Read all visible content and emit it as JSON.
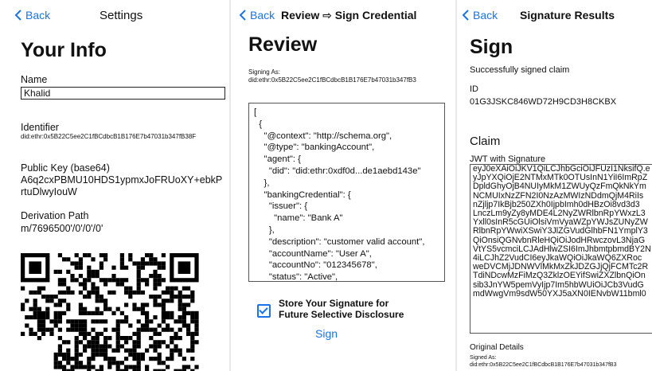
{
  "screen1": {
    "back_label": "Back",
    "nav_title": "Settings",
    "heading": "Your Info",
    "name_label": "Name",
    "name_value": "Khalid",
    "identifier_label": "Identifier",
    "identifier_value": "did:ethr:0x5B22C5ee2C1fBCdbcB1B176E7b47031b347fB38F",
    "pubkey_label": "Public Key (base64)",
    "pubkey_value": "A6q2cxPBMU10HDS1ypmxJoFRUoXY+ebkPrtuDlwyIouW",
    "derivation_label": "Derivation Path",
    "derivation_value": "m/7696500'/0'/0'/0'"
  },
  "screen2": {
    "back_label": "Back",
    "nav_title": "Review ⇨ Sign Credential",
    "heading": "Review",
    "signing_as_label": "Signing As:",
    "signing_as_value": "did:ethr:0x5B22C5ee2C1fBCdbcB1B176E7b47031b347fB3",
    "credential_json": "[\n  {\n    \"@context\": \"http://schema.org\",\n    \"@type\": \"bankingAccount\",\n    \"agent\": {\n      \"did\": \"did:ethr:0xdf0d...de1aebd143e\"\n    },\n    \"bankingCredential\": {\n      \"issuer\": {\n        \"name\": \"Bank A\"\n      },\n      \"description\": \"customer valid account\",\n      \"accountName\": \"User A\",\n      \"accountNo\": \"012345678\",\n      \"status\": \"Active\",\n      \"time\":",
    "checkbox_label": "Store Your Signature for Future Selective Disclosure",
    "checkbox_checked": true,
    "sign_button": "Sign"
  },
  "screen3": {
    "back_label": "Back",
    "nav_title": "Signature Results",
    "heading": "Sign",
    "status_text": "Successfully signed claim",
    "id_label": "ID",
    "id_value": "01G3JSKC846WD72H9CD3H8CKBX",
    "claim_heading": "Claim",
    "jwt_label": "JWT with Signature",
    "jwt_lines": [
      "eyJ0eXAiOiJKV1QiLCJhbGciOiJFUzI1NksifQ.e",
      "yJpYXQiOjE2NTMxMTk0OTUsInN1YiI6ImRpZ",
      "DpldGhyOjB4NUIyMkM1ZWUyQzFmQkNkYm",
      "NCMUIxNzZFN2I0NzAzMWIzNDdmQjM4RiIs",
      "nZjljp7IkBjb250ZXh0IjpbImh0dHBzOi8vd3d3",
      "LnczLm9yZy8yMDE4L2NyZWRlbnRpYWxzL3",
      "Yxll0sInR5cGUiOlsiVmVyaWZpYWJsZUNyZW",
      "RlbnRpYWwiXSwiY3JlZGVudGlhbFN1YmplY3",
      "QiOnsiQGNvbnRleHQiOiJodHRwczovL3NjaG",
      "VtYS5vcmciLCJAdHlwZSI6ImJhbmtpbmdBY2N",
      "4iLCJhZ2VudCI6eyJkaWQiOiJkaWQ6ZXRoc",
      "weDVCMjJDNWVlMkMxZkJDZGJjQjFCMTc2R",
      "TdiNDcwMzFiMzQ3ZklzOEYifSwiZXZlbnQiOn",
      "sib3JnYW5pemVyIjp7Im5hbWUiOiJCb3VudG",
      "mdWwgVm9sdW50YXJ5aXN0IENvbW11bml0"
    ],
    "original_heading": "Original Details",
    "signed_as_label": "Signed As:",
    "signed_as_value": "did:ethr:0x5B22C5ee2C1fBCdbcB1B176E7b47031b347fB3"
  },
  "colors": {
    "accent": "#1a73e8"
  },
  "icons": {
    "back": "chevron-left-icon",
    "checkbox": "checkbox-checked-icon"
  }
}
